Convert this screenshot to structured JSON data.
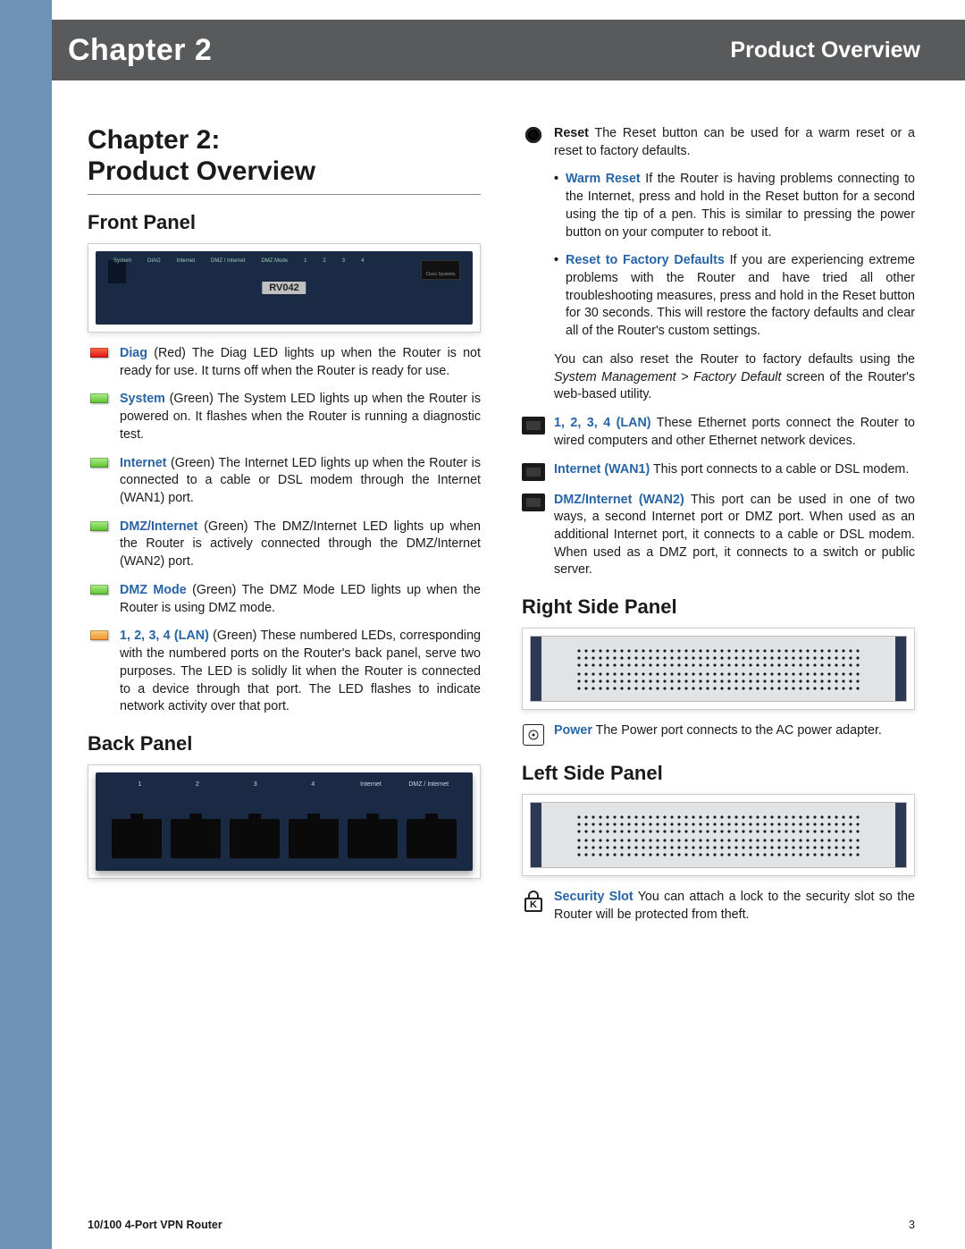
{
  "header": {
    "chapter": "Chapter 2",
    "section": "Product Overview"
  },
  "title": "Chapter 2:\nProduct Overview",
  "front": {
    "heading": "Front Panel",
    "model": "RV042",
    "led_labels": [
      "System",
      "DIAG",
      "Internet",
      "DMZ / Internet",
      "DMZ Mode",
      "1",
      "2",
      "3",
      "4"
    ],
    "brand": "Cisco Systems",
    "items": [
      {
        "kw": "Diag",
        "color": "red",
        "text": "(Red)  The Diag LED lights up when the Router is not ready for use. It turns off when the Router is ready for use."
      },
      {
        "kw": "System",
        "color": "green",
        "text": "(Green)  The System LED lights up when the Router is powered on. It flashes when the Router is running a diagnostic test."
      },
      {
        "kw": "Internet",
        "color": "green",
        "text": "(Green)  The Internet LED lights up when the Router is connected to a cable or DSL modem through the Internet (WAN1) port."
      },
      {
        "kw": "DMZ/Internet",
        "color": "green",
        "text": "(Green)  The DMZ/Internet LED lights up when the Router is actively connected through the DMZ/Internet (WAN2) port."
      },
      {
        "kw": "DMZ Mode",
        "color": "green",
        "text": "(Green)  The DMZ Mode LED lights up when the Router is using DMZ mode."
      },
      {
        "kw": "1, 2, 3, 4 (LAN)",
        "color": "orange",
        "text": "(Green)  These numbered LEDs, corresponding with the numbered ports on the Router's back panel, serve two purposes. The LED is solidly lit when the Router is connected to a device through that port. The LED flashes to indicate network activity over that port."
      }
    ]
  },
  "back": {
    "heading": "Back Panel",
    "port_labels": [
      "1",
      "2",
      "3",
      "4",
      "Internet",
      "DMZ / Internet"
    ]
  },
  "reset": {
    "kw": "Reset",
    "text": "The Reset button can be used for a warm reset or a reset to factory defaults.",
    "bullets": [
      {
        "kw": "Warm Reset",
        "text": "If the Router is having problems connecting to the Internet, press and hold in the Reset button for a second using the tip of a pen. This is similar to pressing the power button on your computer to reboot it."
      },
      {
        "kw": "Reset to Factory Defaults",
        "text": "If you are experiencing extreme problems with the Router and have tried all other troubleshooting measures, press and hold in the Reset button for 30 seconds. This will restore the factory defaults and clear all of the Router's custom settings."
      }
    ],
    "tail_pre": "You can also reset the Router to factory defaults using the ",
    "tail_ital": "System Management > Factory Default",
    "tail_post": " screen of the Router's web-based utility."
  },
  "ports": [
    {
      "kw": "1, 2, 3, 4 (LAN)",
      "text": "These Ethernet ports connect the Router to wired computers and other Ethernet network devices."
    },
    {
      "kw": "Internet (WAN1)",
      "text": "This port connects to a cable or DSL modem."
    },
    {
      "kw": "DMZ/Internet (WAN2)",
      "text": "This port can be used in one of two ways, a second Internet port or DMZ port. When used as an additional Internet port, it connects to a cable or DSL modem. When used as a DMZ port, it connects to a switch or public server."
    }
  ],
  "right": {
    "heading": "Right Side Panel",
    "power_kw": "Power",
    "power_text": "The Power port connects to the AC power adapter."
  },
  "left": {
    "heading": "Left Side Panel",
    "lock_kw": "Security Slot",
    "lock_text": "You can attach a lock to the security slot so the Router will be protected from theft.",
    "lock_letter": "K"
  },
  "footer": {
    "product": "10/100 4-Port VPN Router",
    "page": "3"
  }
}
